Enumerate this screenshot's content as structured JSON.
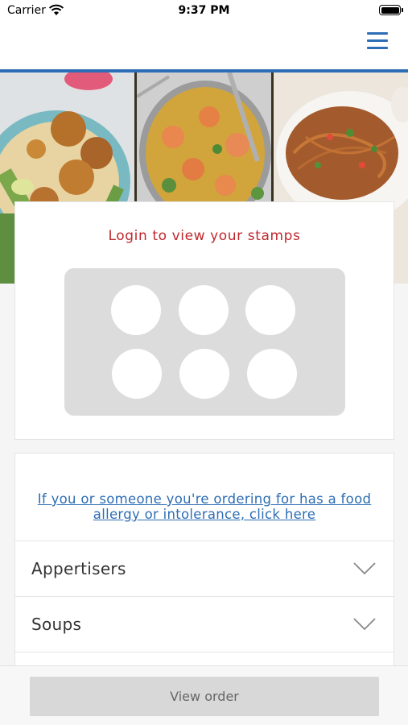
{
  "status_bar": {
    "carrier": "Carrier",
    "time": "9:37 PM",
    "wifi_icon": "wifi-icon",
    "battery_icon": "battery-icon"
  },
  "header": {
    "menu_icon": "hamburger-menu-icon",
    "accent_color": "#2d6db5"
  },
  "hero": {
    "images": [
      "chicken-biryani-image",
      "shrimp-curry-image",
      "noodles-image"
    ]
  },
  "stamps": {
    "title": "Login to view your stamps",
    "title_color": "#c0282d",
    "count": 6
  },
  "allergy": {
    "link_text": "If you or someone you're ordering for has a food allergy or intolerance, click here"
  },
  "menu": {
    "categories": [
      {
        "label": "Appertisers"
      },
      {
        "label": "Soups"
      }
    ],
    "chevron_icon": "chevron-down-icon"
  },
  "footer": {
    "view_order_label": "View order"
  }
}
